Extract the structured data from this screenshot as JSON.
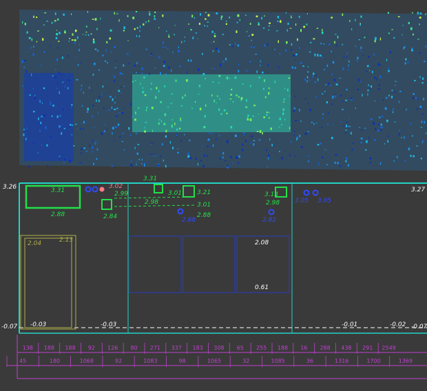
{
  "colors": {
    "background": "#3a3a3a",
    "frame": "#22d3c8",
    "annotation_green": "#22e04a",
    "annotation_white": "#ffffff",
    "annotation_blue": "#2f4bff",
    "annotation_pink": "#ff7a8a",
    "door_frame": "#b0b04a",
    "panel_blue": "#2a3fae",
    "dimension_magenta": "#c040d0"
  },
  "point_cloud": {
    "label": "scanned wall elevation point cloud",
    "palette": [
      "#0b2fb8",
      "#1663d8",
      "#1c8fe8",
      "#1fb7e0",
      "#25d6b8",
      "#3ee08a",
      "#7ef05a",
      "#c9f04a"
    ]
  },
  "elevations": {
    "top_left": "3.26",
    "top_right": "3.27",
    "bottom_left": "-0.07",
    "bottom_right": "-0.07",
    "floor_a": "-0.03",
    "floor_b": "-0.03",
    "floor_c": "-0.01",
    "floor_d": "-0.02"
  },
  "annotations": {
    "box1_top": "3.31",
    "box1_bottom": "2.88",
    "pink_top": "3.02",
    "pink_mid": "2.99",
    "small_box_bottom": "2.84",
    "small_box_top": "3.31",
    "mid_a": "3.01",
    "mid_b": "2.98",
    "mid_c": "3.21",
    "mid_d": "3.01",
    "mid_e": "2.88",
    "blue_mid": "2.68",
    "right_a": "3.14",
    "right_b": "2.98",
    "right_c": "3.05",
    "right_d": "3.05",
    "right_blue": "2.82",
    "door_top": "2.04",
    "door_right": "2.13",
    "panel_top": "2.08",
    "panel_bottom": "0.61"
  },
  "dimensions": {
    "row1": [
      "138",
      "188",
      "188",
      "92",
      "126",
      "80",
      "271",
      "337",
      "183",
      "308",
      "65",
      "255",
      "188",
      "16",
      "288",
      "438",
      "291",
      "2549"
    ],
    "row2": [
      "45",
      "180",
      "1068",
      "92",
      "1083",
      "98",
      "1065",
      "32",
      "1085",
      "36",
      "1316",
      "1700",
      "1369"
    ]
  }
}
